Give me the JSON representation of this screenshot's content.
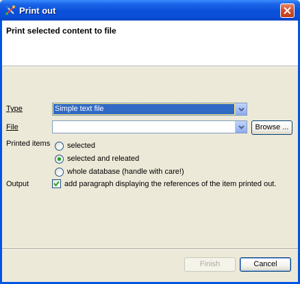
{
  "window": {
    "title": "Print out"
  },
  "banner": {
    "title": "Print selected content to file"
  },
  "form": {
    "type_label": "Type",
    "type_value": "Simple text file",
    "file_label": "File",
    "file_value": "",
    "browse_label": "Browse ...",
    "printed_items_label": "Printed items",
    "radios": [
      {
        "label": "selected",
        "checked": false
      },
      {
        "label": "selected and releated",
        "checked": true
      },
      {
        "label": "whole database (handle with care!)",
        "checked": false
      }
    ],
    "output_label": "Output",
    "output_checkbox_label": "add paragraph displaying the references of the item printed out.",
    "output_checked": true
  },
  "footer": {
    "finish_label": "Finish",
    "finish_enabled": false,
    "cancel_label": "Cancel"
  },
  "colors": {
    "titlebar": "#0a4fd8",
    "selection": "#316ac5",
    "radio_dot": "#21a121"
  },
  "icons": {
    "app": "tools-icon",
    "close": "close-icon",
    "dropdown": "chevron-down-icon",
    "check": "checkmark-icon"
  }
}
